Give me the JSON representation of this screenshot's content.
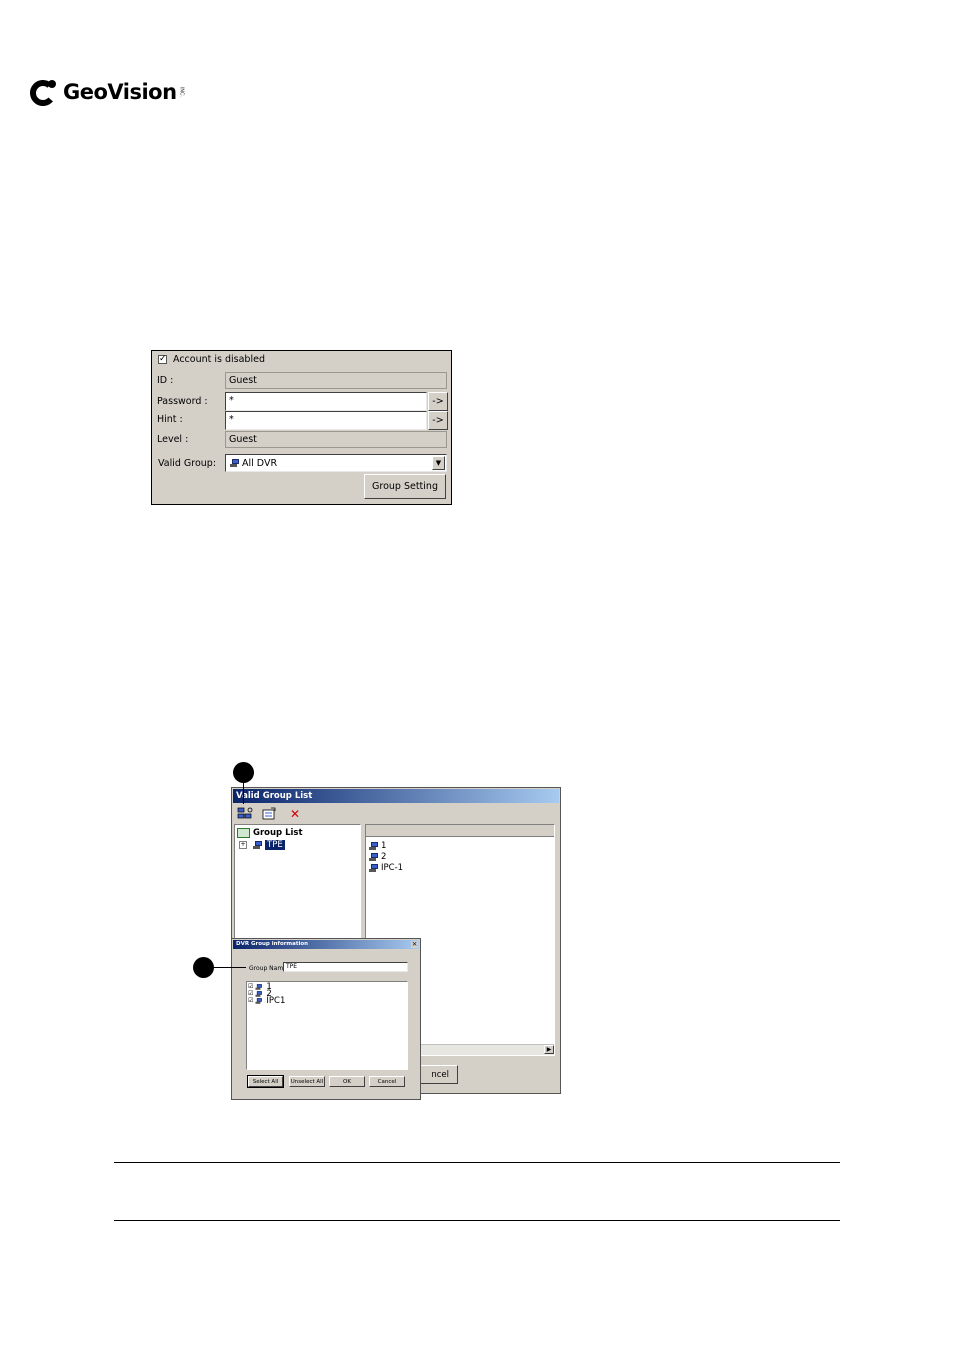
{
  "logo": {
    "text": "GeoVision",
    "tm": "INC."
  },
  "account_panel": {
    "disabled_checkbox": {
      "label": "Account is disabled",
      "checked": true
    },
    "id": {
      "label": "ID :",
      "value": "Guest"
    },
    "password": {
      "label": "Password :",
      "value": "*",
      "button": "->"
    },
    "hint": {
      "label": "Hint :",
      "value": "*",
      "button": "->"
    },
    "level": {
      "label": "Level :",
      "value": "Guest"
    },
    "valid_group": {
      "label": "Valid Group:",
      "value": "All DVR"
    },
    "group_setting_button": "Group Setting"
  },
  "valid_group_window": {
    "title": "Valid Group List",
    "tree": {
      "root": "Group List",
      "items": [
        "TPE"
      ]
    },
    "list_items": [
      "1",
      "2",
      "IPC-1"
    ],
    "cancel_button_partial": "ncel"
  },
  "dvr_group_dialog": {
    "title": "DVR Group information",
    "close": "×",
    "group_name_label": "Group Name",
    "group_name_value": "TPE",
    "items": [
      {
        "label": "1",
        "checked": true
      },
      {
        "label": "2",
        "checked": true
      },
      {
        "label": "IPC1",
        "checked": true
      }
    ],
    "buttons": {
      "select_all": "Select All",
      "unselect_all": "Unselect All",
      "ok": "OK",
      "cancel": "Cancel"
    }
  }
}
